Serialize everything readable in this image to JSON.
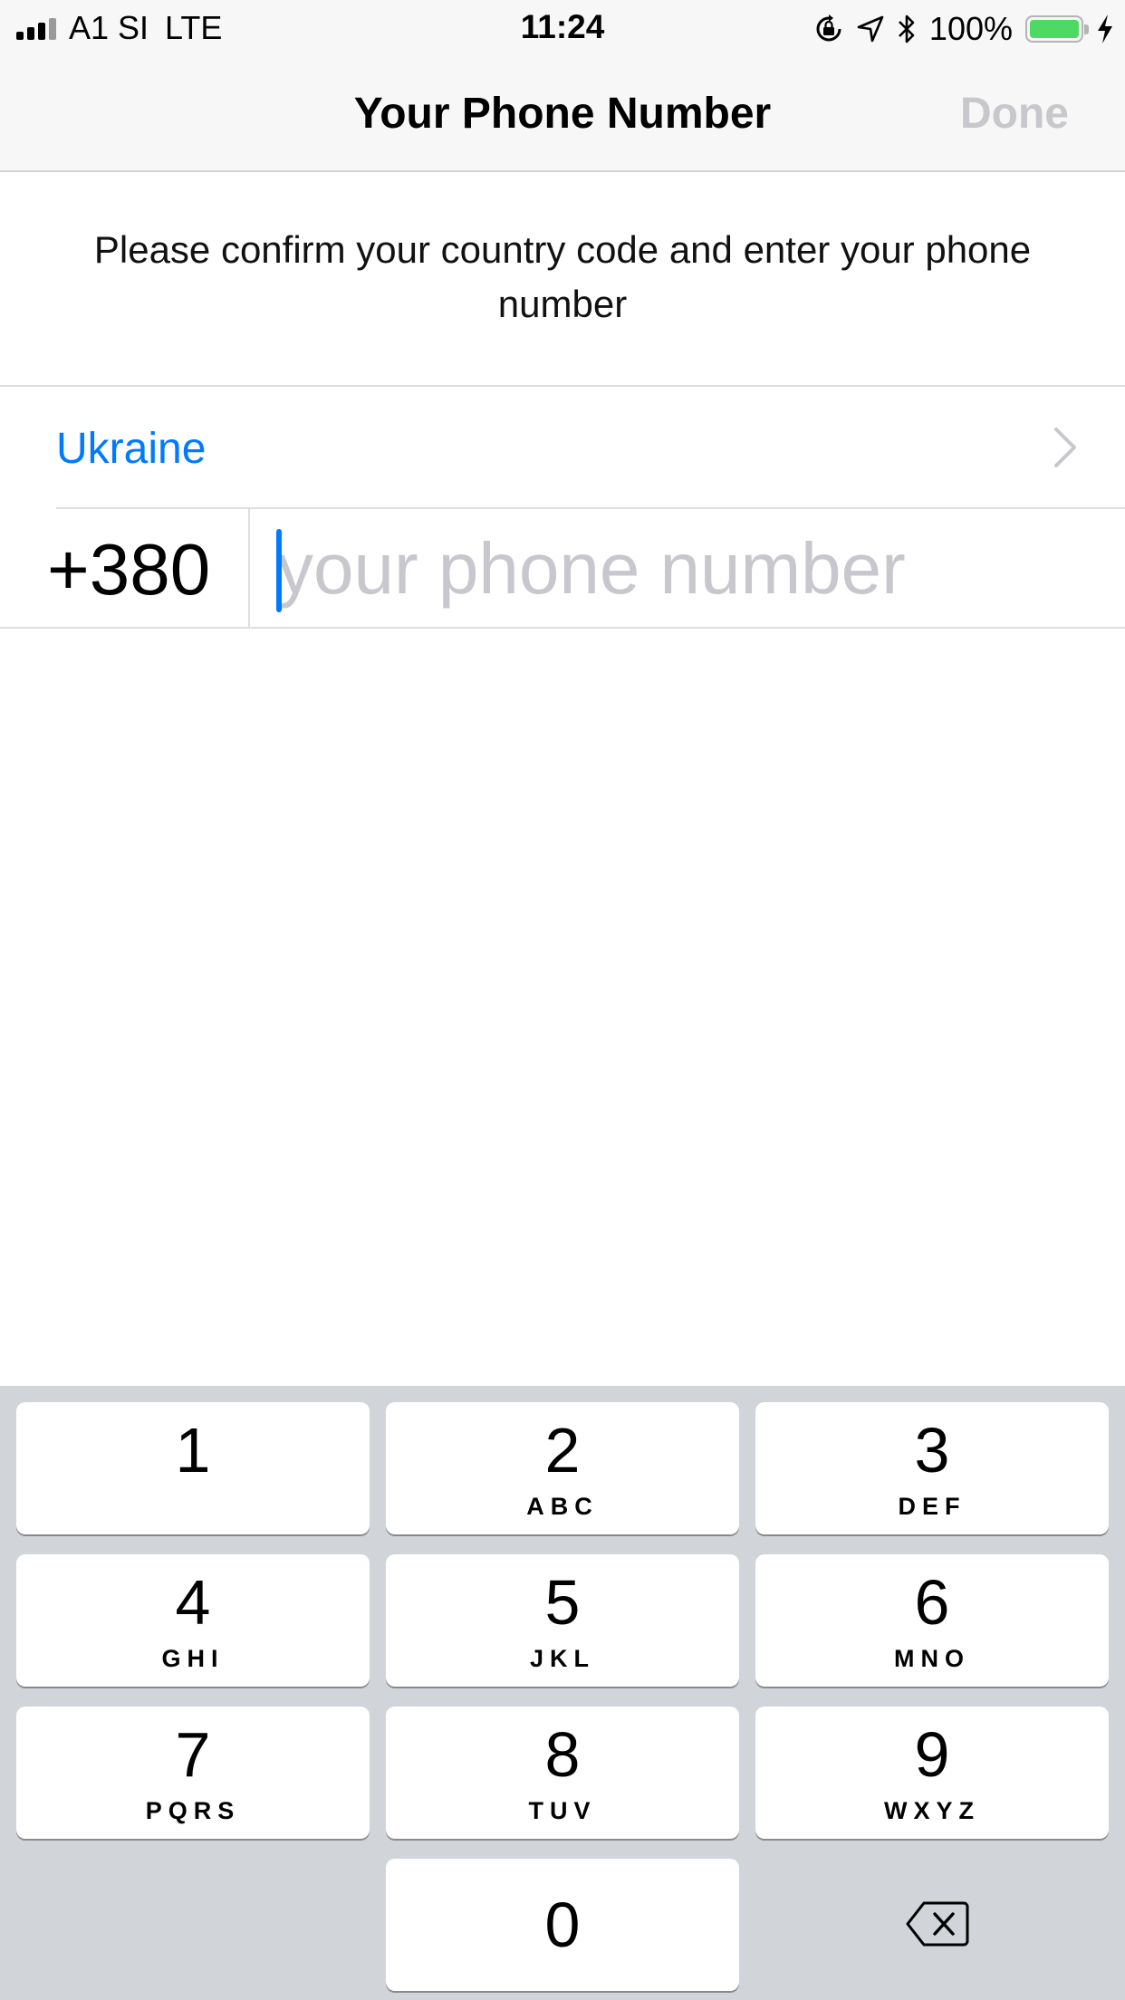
{
  "status_bar": {
    "carrier": "A1 SI",
    "network": "LTE",
    "time": "11:24",
    "battery_percent": "100%",
    "battery_level": 1.0,
    "battery_color": "#4cd964",
    "icons": [
      "signal-icon",
      "rotation-lock-icon",
      "location-icon",
      "bluetooth-icon",
      "battery-icon",
      "charging-icon"
    ]
  },
  "nav": {
    "title": "Your Phone Number",
    "done_label": "Done"
  },
  "instructions": "Please confirm your country code and enter your phone number",
  "country": {
    "name": "Ukraine",
    "code": "+380"
  },
  "phone_input": {
    "value": "",
    "placeholder": "your phone number"
  },
  "colors": {
    "accent": "#007aff",
    "disabled": "#c7c7cc",
    "keyboard_bg": "#d1d4d9"
  },
  "keypad": {
    "keys": [
      {
        "digit": "1",
        "letters": ""
      },
      {
        "digit": "2",
        "letters": "ABC"
      },
      {
        "digit": "3",
        "letters": "DEF"
      },
      {
        "digit": "4",
        "letters": "GHI"
      },
      {
        "digit": "5",
        "letters": "JKL"
      },
      {
        "digit": "6",
        "letters": "MNO"
      },
      {
        "digit": "7",
        "letters": "PQRS"
      },
      {
        "digit": "8",
        "letters": "TUV"
      },
      {
        "digit": "9",
        "letters": "WXYZ"
      },
      {
        "digit": "0",
        "letters": ""
      }
    ]
  }
}
